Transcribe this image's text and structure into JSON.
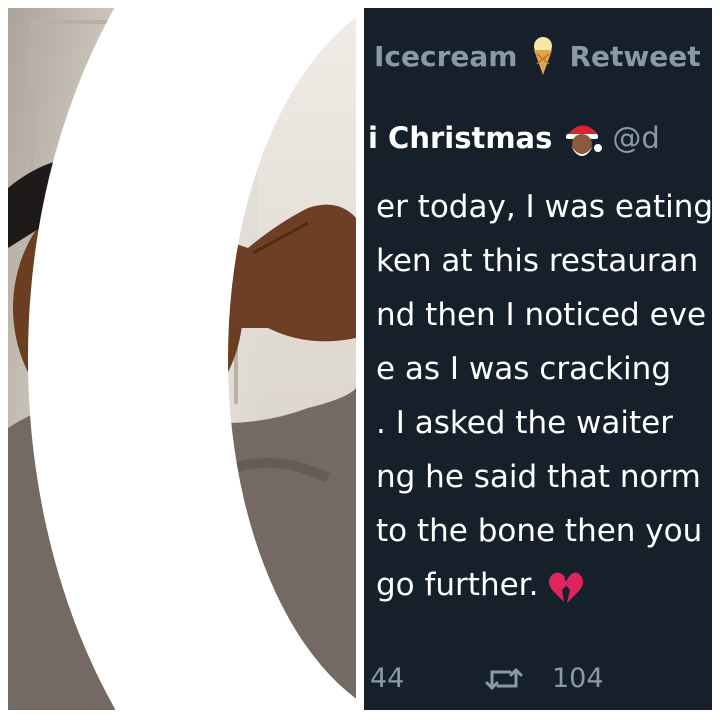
{
  "photo": {
    "description_icon": "selfie-photo"
  },
  "tweet": {
    "retweet_label_start": "Icecream",
    "retweet_label_end": "Retweet",
    "retweet_icon": "icecream-icon",
    "display_name": "i Christmas",
    "name_icon": "santa-emoji-icon",
    "handle": "@d",
    "lines": [
      "er today, I was eating",
      "ken at this restauran",
      "nd then I noticed eve",
      "e as I was cracking",
      ". I asked the waiter",
      "ng he said that norm",
      "to the bone then you",
      "go further."
    ],
    "end_icon": "broken-heart-icon",
    "reply_count": "44",
    "retweet_count": "104"
  },
  "colors": {
    "tweet_bg": "#15202b",
    "muted": "#8b98a5",
    "text": "#ffffff",
    "heart": "#e0245e"
  }
}
